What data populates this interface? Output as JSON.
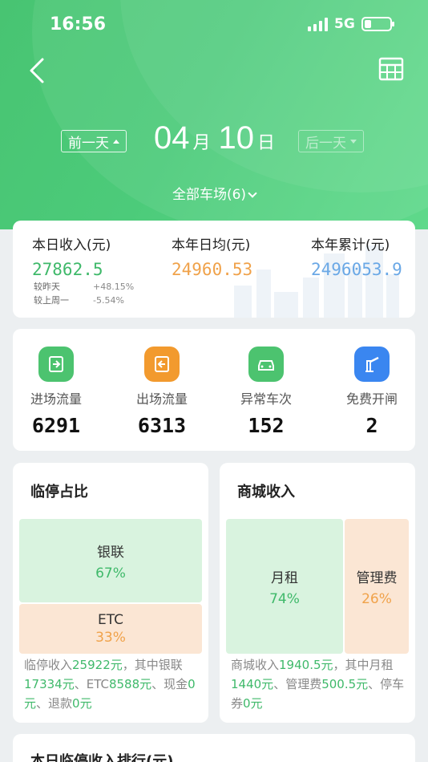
{
  "status_bar": {
    "time": "16:56",
    "network": "5G"
  },
  "header": {
    "prev_day_label": "前一天",
    "next_day_label": "后一天",
    "month": "04",
    "month_unit": "月",
    "day": "10",
    "day_unit": "日",
    "lot_selector": "全部车场(6)"
  },
  "summary": {
    "today_label": "本日收入(元)",
    "today_value": "27862.5",
    "year_avg_label": "本年日均(元)",
    "year_avg_value": "24960.53",
    "year_total_label": "本年累计(元)",
    "year_total_value": "2496053.9",
    "vs_yesterday_label": "较昨天",
    "vs_yesterday_value": "+48.15%",
    "vs_last_week_label": "较上周一",
    "vs_last_week_value": "-5.54%"
  },
  "flow": [
    {
      "label": "进场流量",
      "value": "6291",
      "icon": "entry-gate-icon",
      "color": "#4cc36f"
    },
    {
      "label": "出场流量",
      "value": "6313",
      "icon": "exit-gate-icon",
      "color": "#f29a2e"
    },
    {
      "label": "异常车次",
      "value": "152",
      "icon": "car-icon",
      "color": "#4cc36f"
    },
    {
      "label": "免费开闸",
      "value": "2",
      "icon": "barrier-icon",
      "color": "#3a86f0"
    }
  ],
  "temp_parking": {
    "title": "临停占比",
    "blocks": [
      {
        "name": "银联",
        "percent": "67%"
      },
      {
        "name": "ETC",
        "percent": "33%"
      }
    ],
    "desc": {
      "p1": "临停收入",
      "total": "25922元",
      "p2": "，其中银联",
      "unionpay": "17334元",
      "p3": "、ETC",
      "etc": "8588元",
      "p4": "、现金",
      "cash": "0元",
      "p5": "、退款",
      "refund": "0元"
    }
  },
  "mall_income": {
    "title": "商城收入",
    "blocks": [
      {
        "name": "月租",
        "percent": "74%"
      },
      {
        "name": "管理费",
        "percent": "26%"
      }
    ],
    "desc": {
      "p1": "商城收入",
      "total": "1940.5元",
      "p2": "，其中月租",
      "monthly": "1440元",
      "p3": "、管理费",
      "mgmt": "500.5元",
      "p4": "、停车券",
      "coupon": "0元"
    }
  },
  "ranking": {
    "title": "本日临停收入排行(元)"
  }
}
